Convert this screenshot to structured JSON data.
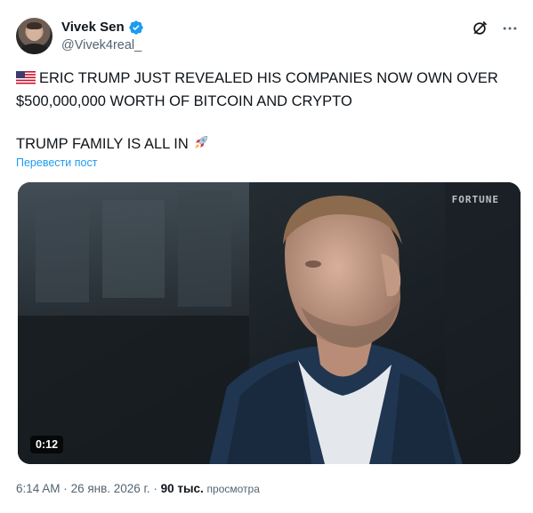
{
  "author": {
    "display_name": "Vivek Sen",
    "handle": "@Vivek4real_",
    "verified": true,
    "verified_color": "#1d9bf0"
  },
  "header_actions": {
    "grok_icon": "grok-icon",
    "more_icon": "more-icon"
  },
  "post": {
    "flag_emoji": "us-flag-icon",
    "line1": "ERIC TRUMP JUST REVEALED HIS COMPANIES NOW OWN OVER",
    "line2": "$500,000,000 WORTH OF BITCOIN AND CRYPTO",
    "line3": "TRUMP FAMILY IS ALL IN",
    "trailing_emoji": "rocket-icon"
  },
  "translate_link": "Перевести пост",
  "media": {
    "watermark": "FORTUNE",
    "duration": "0:12"
  },
  "meta": {
    "time": "6:14 AM",
    "separator": "·",
    "date": "26 янв. 2026 г.",
    "views_count": "90 тыс.",
    "views_label": "просмотра"
  },
  "colors": {
    "text": "#0f1419",
    "secondary": "#536471",
    "link": "#1d9bf0"
  }
}
